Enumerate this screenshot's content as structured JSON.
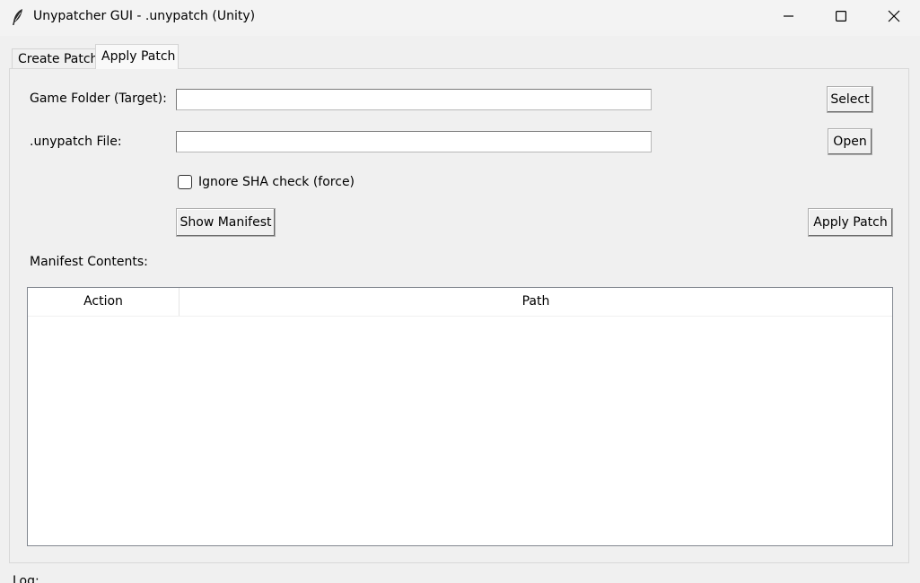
{
  "window": {
    "title": "Unypatcher GUI - .unypatch (Unity)",
    "icon": "feather-icon",
    "controls": [
      "minimize-icon",
      "maximize-icon",
      "close-icon"
    ]
  },
  "tabs": [
    {
      "label": "Create Patch",
      "selected": false
    },
    {
      "label": "Apply Patch",
      "selected": true
    }
  ],
  "apply_patch": {
    "game_folder_label": "Game Folder (Target):",
    "game_folder_value": "",
    "select_button": "Select",
    "patch_file_label": ".unypatch File:",
    "patch_file_value": "",
    "open_button": "Open",
    "ignore_sha_label": "Ignore SHA check (force)",
    "ignore_sha_checked": false,
    "show_manifest_button": "Show Manifest",
    "apply_patch_button": "Apply Patch",
    "manifest_label": "Manifest Contents:",
    "manifest_columns": [
      "Action",
      "Path"
    ],
    "manifest_rows": []
  },
  "log_label": "Log:"
}
